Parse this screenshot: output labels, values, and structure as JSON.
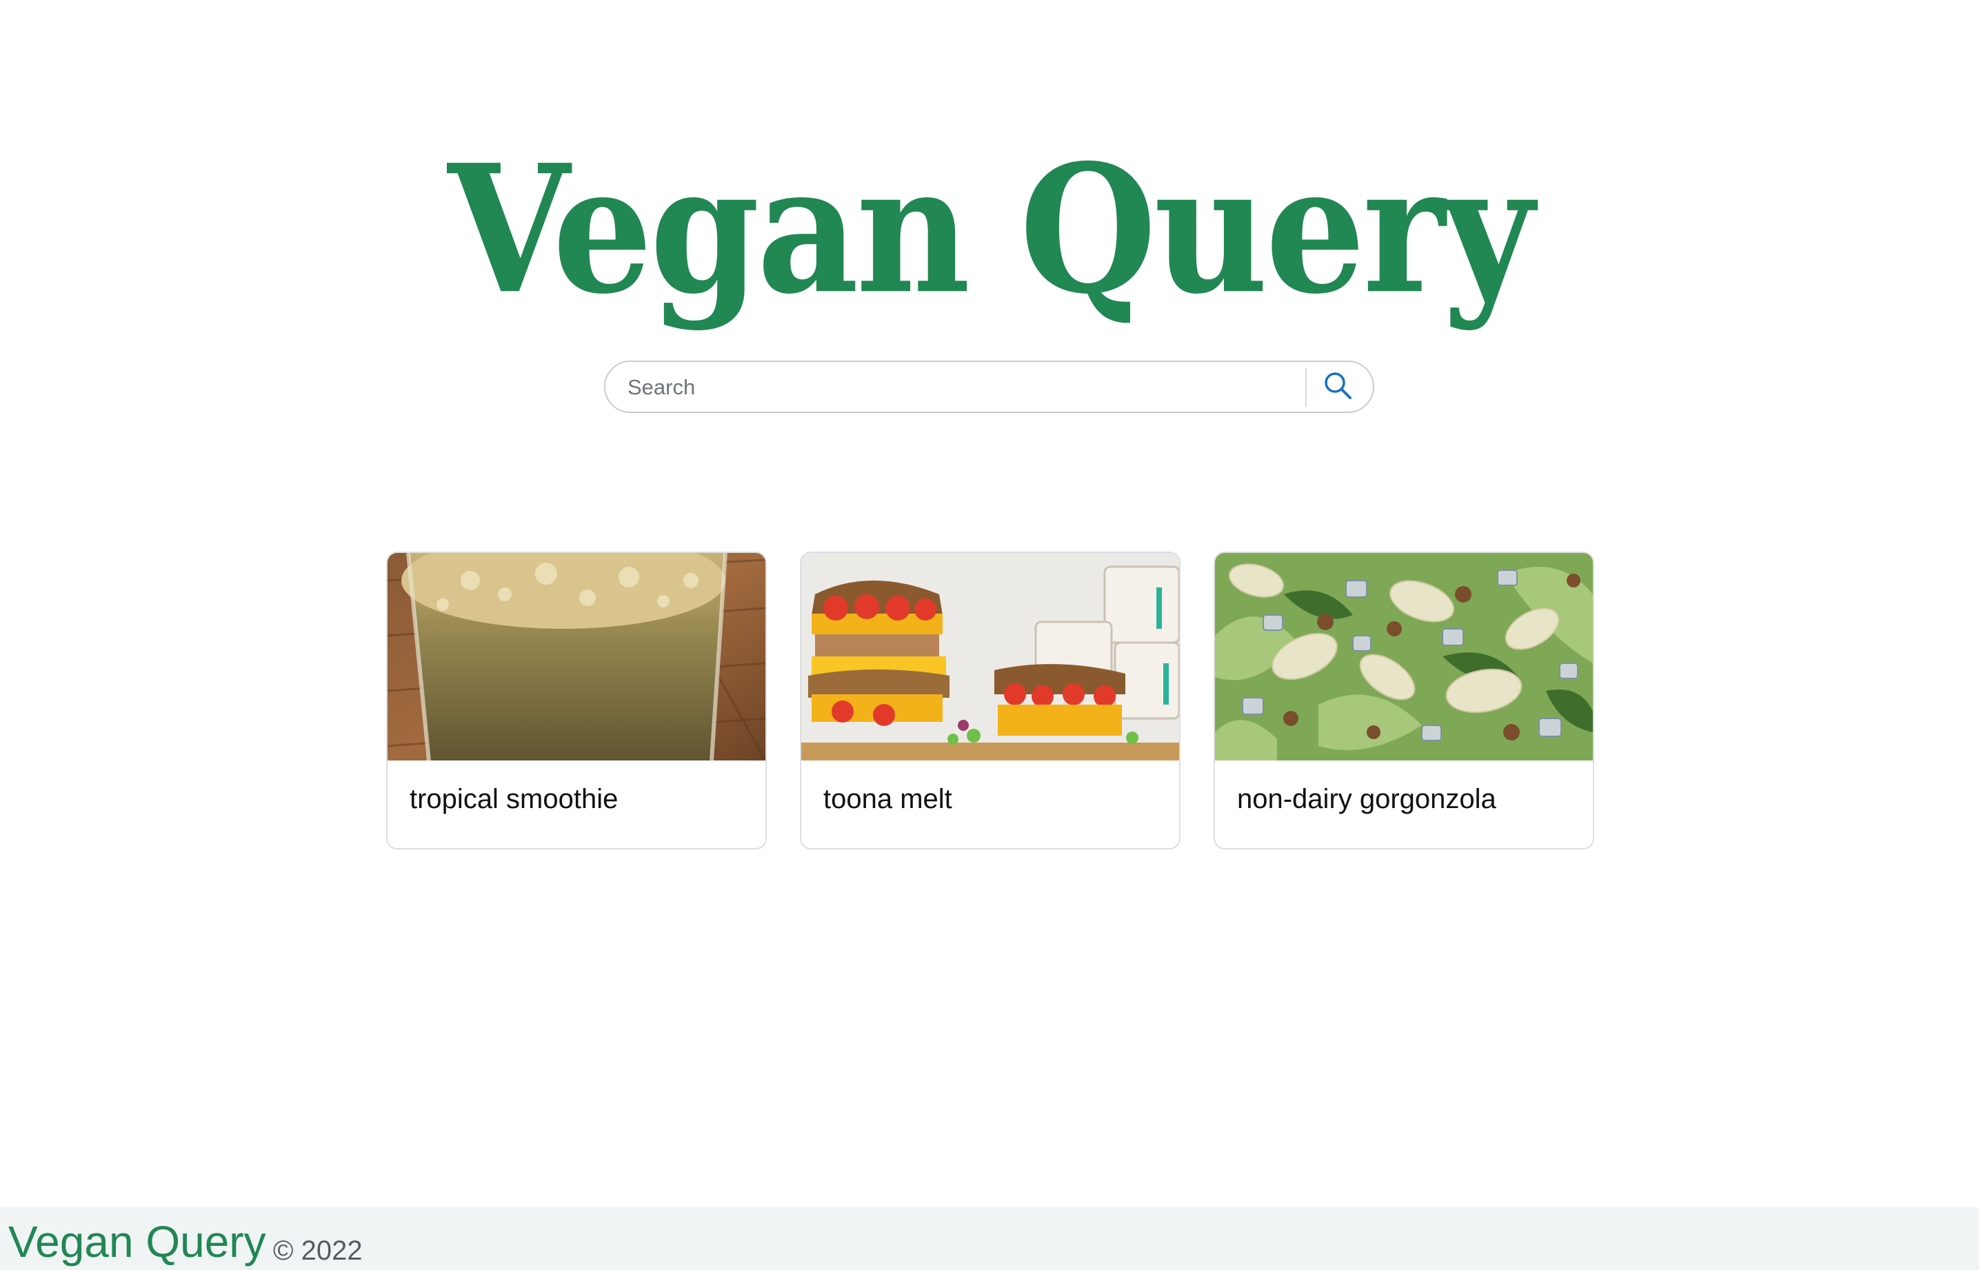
{
  "header": {
    "logo_text": "Vegan Query"
  },
  "search": {
    "placeholder": "Search",
    "value": "",
    "button_icon": "search-icon"
  },
  "cards": [
    {
      "title": "tropical smoothie"
    },
    {
      "title": "toona melt"
    },
    {
      "title": "non-dairy gorgonzola"
    }
  ],
  "footer": {
    "brand": "Vegan Query",
    "copyright": "© 2022"
  },
  "colors": {
    "brand_green": "#218753",
    "search_icon_blue": "#1a6fc0",
    "footer_background": "#f1f4f5"
  }
}
